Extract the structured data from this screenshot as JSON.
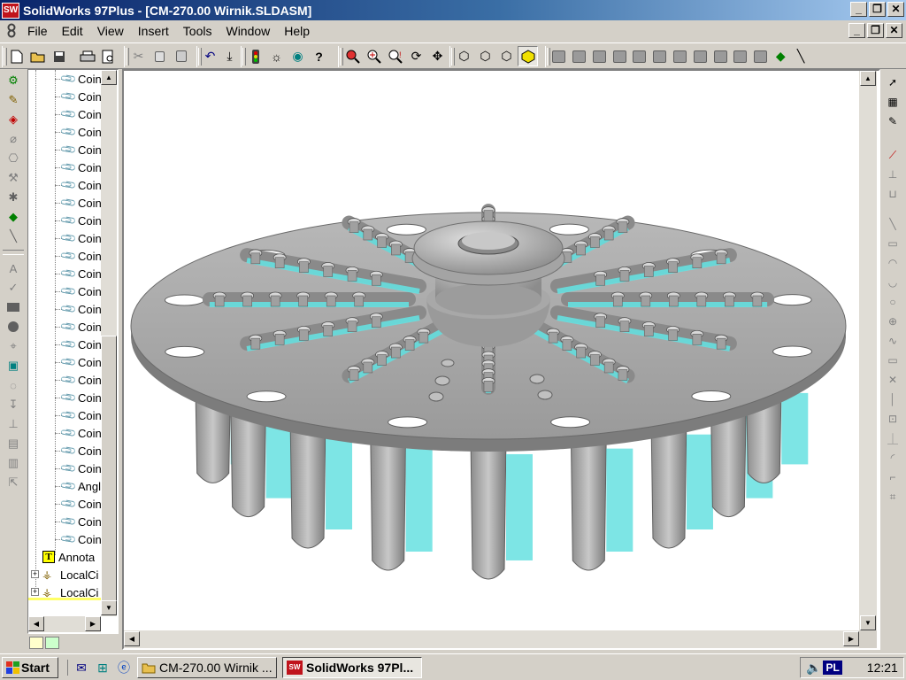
{
  "window": {
    "app_logo": "SW",
    "title": "SolidWorks 97Plus - [CM-270.00 Wirnik.SLDASM]",
    "minimize_glyph": "_",
    "restore_glyph": "❐",
    "close_glyph": "✕"
  },
  "menu": {
    "items": [
      "File",
      "Edit",
      "View",
      "Insert",
      "Tools",
      "Window",
      "Help"
    ]
  },
  "feature_tree": {
    "rows": [
      {
        "icon": "paperclip-icon",
        "label": "Coin"
      },
      {
        "icon": "paperclip-icon",
        "label": "Coin"
      },
      {
        "icon": "paperclip-icon",
        "label": "Coin"
      },
      {
        "icon": "paperclip-icon",
        "label": "Coin"
      },
      {
        "icon": "paperclip-icon",
        "label": "Coin"
      },
      {
        "icon": "paperclip-icon",
        "label": "Coin"
      },
      {
        "icon": "paperclip-icon",
        "label": "Coin"
      },
      {
        "icon": "paperclip-icon",
        "label": "Coin"
      },
      {
        "icon": "paperclip-icon",
        "label": "Coin"
      },
      {
        "icon": "paperclip-icon",
        "label": "Coin"
      },
      {
        "icon": "paperclip-icon",
        "label": "Coin"
      },
      {
        "icon": "paperclip-icon",
        "label": "Coin"
      },
      {
        "icon": "paperclip-icon",
        "label": "Coin"
      },
      {
        "icon": "paperclip-icon",
        "label": "Coin"
      },
      {
        "icon": "paperclip-icon",
        "label": "Coin"
      },
      {
        "icon": "paperclip-icon",
        "label": "Coin"
      },
      {
        "icon": "paperclip-icon",
        "label": "Coin"
      },
      {
        "icon": "paperclip-icon",
        "label": "Coin"
      },
      {
        "icon": "paperclip-icon",
        "label": "Coin"
      },
      {
        "icon": "paperclip-icon",
        "label": "Coin"
      },
      {
        "icon": "paperclip-icon",
        "label": "Coin"
      },
      {
        "icon": "paperclip-icon",
        "label": "Coin"
      },
      {
        "icon": "paperclip-icon",
        "label": "Coin"
      },
      {
        "icon": "paperclip-icon",
        "label": "Angl"
      },
      {
        "icon": "paperclip-icon",
        "label": "Coin"
      },
      {
        "icon": "paperclip-icon",
        "label": "Coin"
      },
      {
        "icon": "paperclip-icon",
        "label": "Coin"
      }
    ],
    "annotations_label": "Annota",
    "local_patterns": [
      "LocalCi",
      "LocalCi"
    ],
    "expand_glyph": "+"
  },
  "colors": {
    "title_gradient_start": "#0a246a",
    "title_gradient_end": "#a6caf0",
    "model_gray": "#a8a8a8",
    "model_dark": "#6c6c6c",
    "model_cyan": "#66e0e0",
    "face_bg": "#d4d0c8"
  },
  "taskbar": {
    "start_label": "Start",
    "tasks": [
      {
        "icon": "folder-icon",
        "label": "CM-270.00 Wirnik ...",
        "active": false
      },
      {
        "icon": "solidworks-icon",
        "label": "SolidWorks 97Pl...",
        "active": true
      }
    ],
    "language": "PL",
    "clock": "12:21"
  }
}
